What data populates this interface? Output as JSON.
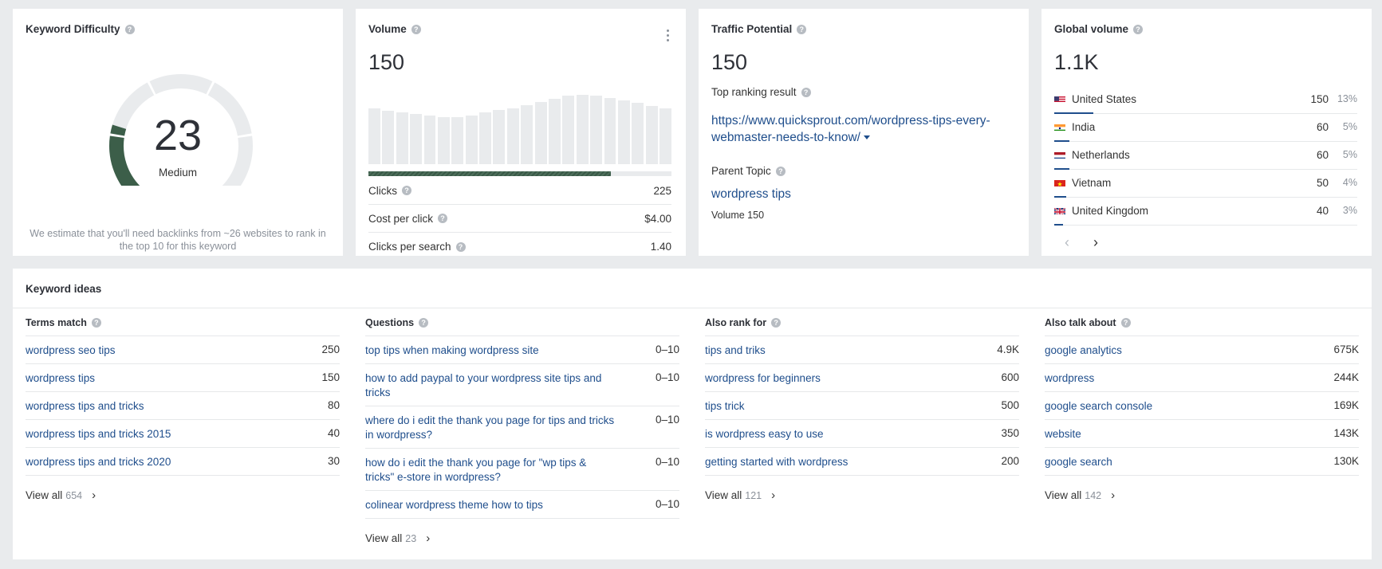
{
  "kd": {
    "title": "Keyword Difficulty",
    "value": "23",
    "label": "Medium",
    "estimate": "We estimate that you'll need backlinks from ~26 websites to rank in the top 10 for this keyword",
    "score": 23,
    "color": "#3c5e49"
  },
  "volume": {
    "title": "Volume",
    "value": "150",
    "history": [
      0.74,
      0.71,
      0.69,
      0.67,
      0.65,
      0.63,
      0.63,
      0.65,
      0.69,
      0.72,
      0.75,
      0.79,
      0.83,
      0.87,
      0.91,
      0.93,
      0.92,
      0.88,
      0.85,
      0.82,
      0.78,
      0.74
    ],
    "clicks_share": 0.8,
    "metrics": [
      {
        "label": "Clicks",
        "value": "225"
      },
      {
        "label": "Cost per click",
        "value": "$4.00"
      },
      {
        "label": "Clicks per search",
        "value": "1.40"
      }
    ]
  },
  "traffic": {
    "title": "Traffic Potential",
    "value": "150",
    "top_label": "Top ranking result",
    "top_url": "https://www.quicksprout.com/wordpress-tips-every-webmaster-needs-to-know/",
    "parent_label": "Parent Topic",
    "parent_topic": "wordpress tips",
    "parent_volume": "Volume 150"
  },
  "global": {
    "title": "Global volume",
    "value": "1.1K",
    "countries": [
      {
        "name": "United States",
        "volume": "150",
        "pct": "13%",
        "share": 0.13,
        "flag": "us"
      },
      {
        "name": "India",
        "volume": "60",
        "pct": "5%",
        "share": 0.05,
        "flag": "in"
      },
      {
        "name": "Netherlands",
        "volume": "60",
        "pct": "5%",
        "share": 0.05,
        "flag": "nl"
      },
      {
        "name": "Vietnam",
        "volume": "50",
        "pct": "4%",
        "share": 0.04,
        "flag": "vn"
      },
      {
        "name": "United Kingdom",
        "volume": "40",
        "pct": "3%",
        "share": 0.03,
        "flag": "gb"
      }
    ],
    "prev": "‹",
    "next": "›"
  },
  "ideas": {
    "title": "Keyword ideas",
    "columns": [
      {
        "title": "Terms match",
        "view_all": "View all",
        "count": "654",
        "rows": [
          {
            "text": "wordpress seo tips",
            "value": "250"
          },
          {
            "text": "wordpress tips",
            "value": "150"
          },
          {
            "text": "wordpress tips and tricks",
            "value": "80"
          },
          {
            "text": "wordpress tips and tricks 2015",
            "value": "40"
          },
          {
            "text": "wordpress tips and tricks 2020",
            "value": "30"
          }
        ]
      },
      {
        "title": "Questions",
        "view_all": "View all",
        "count": "23",
        "rows": [
          {
            "text": "top tips when making wordpress site",
            "value": "0–10"
          },
          {
            "text": "how to add paypal to your wordpress site tips and tricks",
            "value": "0–10"
          },
          {
            "text": "where do i edit the thank you page for tips and tricks in wordpress?",
            "value": "0–10"
          },
          {
            "text": "how do i edit the thank you page for \"wp tips & tricks\" e-store in wordpress?",
            "value": "0–10"
          },
          {
            "text": "colinear wordpress theme how to tips",
            "value": "0–10"
          }
        ]
      },
      {
        "title": "Also rank for",
        "view_all": "View all",
        "count": "121",
        "rows": [
          {
            "text": "tips and triks",
            "value": "4.9K"
          },
          {
            "text": "wordpress for beginners",
            "value": "600"
          },
          {
            "text": "tips trick",
            "value": "500"
          },
          {
            "text": "is wordpress easy to use",
            "value": "350"
          },
          {
            "text": "getting started with wordpress",
            "value": "200"
          }
        ]
      },
      {
        "title": "Also talk about",
        "view_all": "View all",
        "count": "142",
        "rows": [
          {
            "text": "google analytics",
            "value": "675K"
          },
          {
            "text": "wordpress",
            "value": "244K"
          },
          {
            "text": "google search console",
            "value": "169K"
          },
          {
            "text": "website",
            "value": "143K"
          },
          {
            "text": "google search",
            "value": "130K"
          }
        ]
      }
    ]
  }
}
